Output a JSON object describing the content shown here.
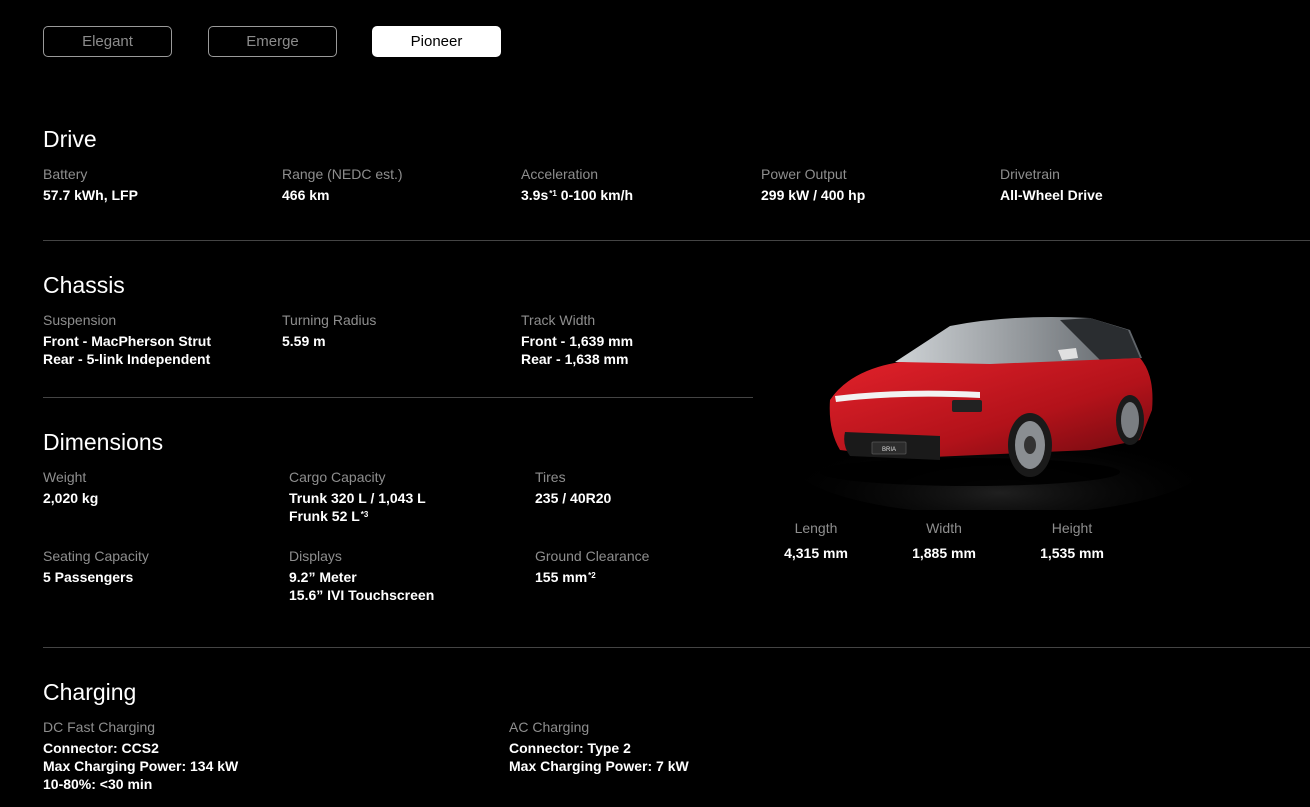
{
  "trims": {
    "elegant": "Elegant",
    "emerge": "Emerge",
    "pioneer": "Pioneer",
    "selected": "Pioneer"
  },
  "drive": {
    "title": "Drive",
    "battery": {
      "label": "Battery",
      "value": "57.7 kWh, LFP"
    },
    "range": {
      "label": "Range (NEDC est.)",
      "value": "466 km"
    },
    "acceleration": {
      "label": "Acceleration",
      "value": "3.9s",
      "footnote": "*1",
      "value_suffix": " 0-100 km/h"
    },
    "power": {
      "label": "Power Output",
      "value": "299 kW / 400 hp"
    },
    "drivetrain": {
      "label": "Drivetrain",
      "value": "All-Wheel Drive"
    }
  },
  "chassis": {
    "title": "Chassis",
    "suspension": {
      "label": "Suspension",
      "line1": "Front - MacPherson Strut",
      "line2": "Rear - 5-link Independent"
    },
    "turning": {
      "label": "Turning Radius",
      "value": "5.59 m"
    },
    "track": {
      "label": "Track Width",
      "line1": "Front - 1,639 mm",
      "line2": "Rear - 1,638 mm"
    }
  },
  "dimensions": {
    "title": "Dimensions",
    "weight": {
      "label": "Weight",
      "value": "2,020 kg"
    },
    "cargo": {
      "label": "Cargo Capacity",
      "line1": "Trunk 320 L / 1,043 L",
      "line2": "Frunk 52 L",
      "footnote": "*3"
    },
    "tires": {
      "label": "Tires",
      "value": "235 / 40R20"
    },
    "seating": {
      "label": "Seating Capacity",
      "value": "5 Passengers"
    },
    "displays": {
      "label": "Displays",
      "line1": "9.2” Meter",
      "line2": "15.6” IVI Touchscreen"
    },
    "clearance": {
      "label": "Ground Clearance",
      "value": "155 mm",
      "footnote": "*2"
    },
    "length": {
      "label": "Length",
      "value": "4,315 mm"
    },
    "width": {
      "label": "Width",
      "value": "1,885 mm"
    },
    "height": {
      "label": "Height",
      "value": "1,535 mm"
    }
  },
  "car_image": {
    "badge": "BRIA",
    "body_color": "#c8141c"
  },
  "charging": {
    "title": "Charging",
    "dc": {
      "label": "DC Fast Charging",
      "line1": "Connector: CCS2",
      "line2": "Max Charging Power: 134 kW",
      "line3": "10-80%: <30 min"
    },
    "ac": {
      "label": "AC Charging",
      "line1": "Connector: Type 2",
      "line2": "Max Charging Power: 7 kW"
    }
  }
}
